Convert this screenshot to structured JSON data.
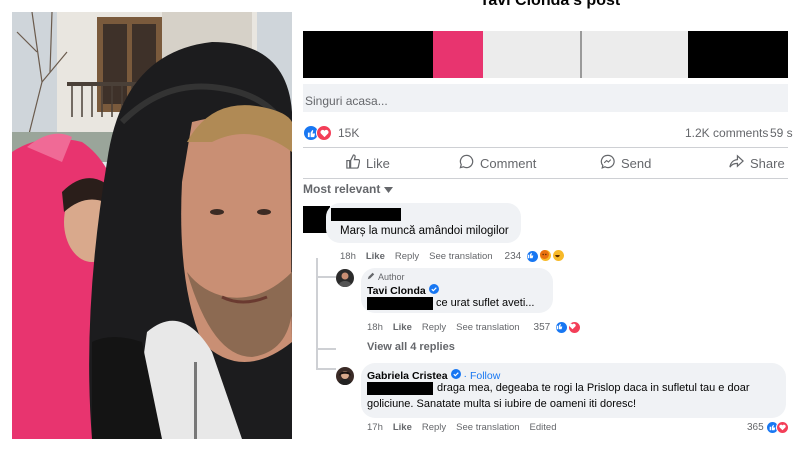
{
  "post": {
    "title": "Tavi Clonda's post",
    "caption": "Singuri acasa...",
    "reaction_count": "15K",
    "comments_count": "1.2K comments",
    "shares_count": "59 s",
    "actions": {
      "like": "Like",
      "comment": "Comment",
      "send": "Send",
      "share": "Share"
    },
    "sort_label": "Most relevant"
  },
  "comments": [
    {
      "text": "Marș la muncă amândoi milogilor",
      "time": "18h",
      "like": "Like",
      "reply": "Reply",
      "translate": "See translation",
      "reactions": "234"
    },
    {
      "author_tag": "Author",
      "name": "Tavi Clonda",
      "text": "ce urat suflet aveti...",
      "time": "18h",
      "like": "Like",
      "reply": "Reply",
      "translate": "See translation",
      "reactions": "357"
    },
    {
      "view_replies": "View all 4 replies"
    },
    {
      "name": "Gabriela Cristea",
      "follow": "· Follow",
      "text_line1": "draga mea, degeaba te rogi la Prislop daca in sufletul tau e doar",
      "text_line2": "goliciune. Sanatate multa si iubire de oameni iti doresc!",
      "time": "17h",
      "like": "Like",
      "reply": "Reply",
      "translate": "See translation",
      "edited": "Edited",
      "reactions": "365"
    }
  ],
  "colors": {
    "like_blue": "#1877f2",
    "love_red": "#f33e58",
    "haha_yellow": "#f7b928",
    "muted_text": "#65676b",
    "bubble_bg": "#f0f2f5",
    "jacket_pink": "#e8346f"
  }
}
